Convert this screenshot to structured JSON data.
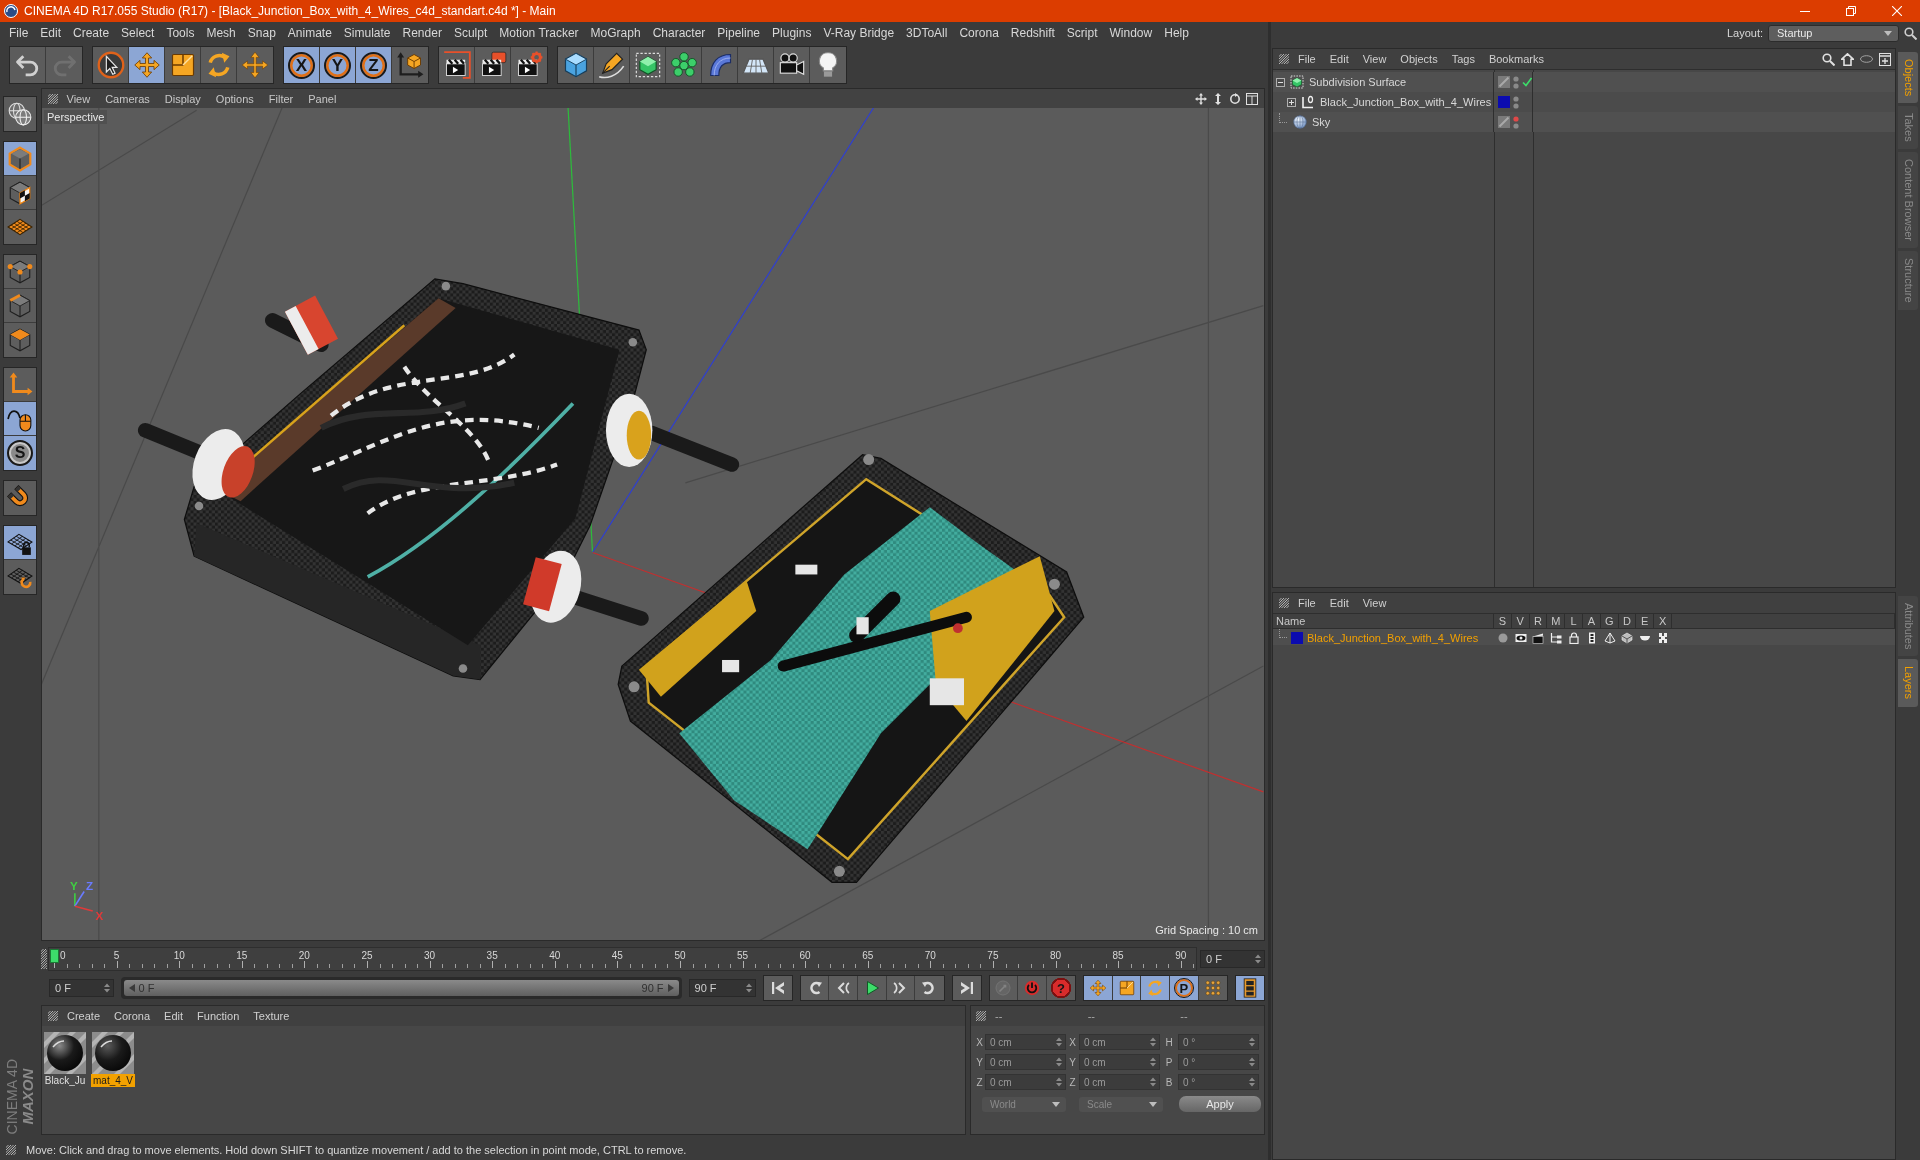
{
  "window": {
    "title": "CINEMA 4D R17.055 Studio (R17) - [Black_Junction_Box_with_4_Wires_c4d_standart.c4d *] - Main"
  },
  "menu_bar": [
    "File",
    "Edit",
    "Create",
    "Select",
    "Tools",
    "Mesh",
    "Snap",
    "Animate",
    "Simulate",
    "Render",
    "Sculpt",
    "Motion Tracker",
    "MoGraph",
    "Character",
    "Pipeline",
    "Plugins",
    "V-Ray Bridge",
    "3DToAll",
    "Corona",
    "Redshift",
    "Script",
    "Window",
    "Help"
  ],
  "layout": {
    "label": "Layout:",
    "value": "Startup"
  },
  "toolbar": [
    [
      {
        "disabled": false
      },
      {
        "disabled": true
      }
    ],
    [
      {
        "on": false
      },
      {
        "on": true
      },
      {
        "on": false
      },
      {
        "on": false
      },
      {
        "on": false
      }
    ],
    [
      {
        "label": "X",
        "on": true
      },
      {
        "label": "Y",
        "on": true
      },
      {
        "label": "Z",
        "on": true
      },
      {
        "on": false
      }
    ],
    [
      {
        "on": false
      },
      {
        "on": false
      },
      {
        "on": false
      }
    ],
    [
      {
        "on": false
      },
      {
        "on": false
      },
      {
        "on": false
      },
      {
        "on": false
      },
      {
        "on": false
      },
      {
        "on": false
      },
      {
        "on": false
      },
      {
        "on": false
      }
    ]
  ],
  "tool_palette": [
    [
      {
        "on": false
      }
    ],
    [
      {
        "on": true
      },
      {
        "on": false
      },
      {
        "on": false
      }
    ],
    [
      {
        "on": false
      },
      {
        "on": false
      },
      {
        "on": false
      }
    ],
    [
      {
        "on": false
      },
      {
        "on": true
      },
      {
        "label": "S",
        "on": true
      }
    ],
    [
      {
        "on": false
      }
    ],
    [
      {
        "on": true
      },
      {
        "on": false
      }
    ]
  ],
  "viewport": {
    "menu": [
      "View",
      "Cameras",
      "Display",
      "Options",
      "Filter",
      "Panel"
    ],
    "camera": "Perspective",
    "gizmo": [
      {
        "label": "Y",
        "color": "#3fd042"
      },
      {
        "label": "Z",
        "color": "#6a7bff"
      },
      {
        "label": "X",
        "color": "#e03a3a"
      }
    ],
    "grid_spacing": "Grid Spacing : 10 cm"
  },
  "timeline": {
    "ticks": [
      "0",
      "5",
      "10",
      "15",
      "20",
      "25",
      "30",
      "35",
      "40",
      "45",
      "50",
      "55",
      "60",
      "65",
      "70",
      "75",
      "80",
      "85",
      "90"
    ],
    "current_frame": "0 F"
  },
  "transport": {
    "start_frame": "0 F",
    "range": {
      "start": "0 F",
      "end": "90 F",
      "level": 1
    },
    "end_frame": "90 F",
    "record_tools": [
      {
        "disabled": true
      },
      {
        "disabled": false
      },
      {
        "label": "?",
        "disabled": false
      }
    ],
    "key_tools": [
      {
        "on": true
      },
      {
        "on": true
      },
      {
        "on": true
      },
      {
        "label": "P",
        "on": true
      },
      {
        "on": false
      }
    ],
    "timeline_button": {
      "on": true
    }
  },
  "materials": {
    "menu": [
      "Create",
      "Corona",
      "Edit",
      "Function",
      "Texture"
    ],
    "items": [
      {
        "name": "Black_Ju",
        "selected": false
      },
      {
        "name": "mat_4_V",
        "selected": true
      }
    ]
  },
  "coordinates": {
    "headers": [
      "--",
      "--",
      "--"
    ],
    "rows": [
      {
        "position_axis": "X",
        "position": "0 cm",
        "size_axis": "X",
        "size": "0 cm",
        "rotation_axis": "H",
        "rotation": "0 °"
      },
      {
        "position_axis": "Y",
        "position": "0 cm",
        "size_axis": "Y",
        "size": "0 cm",
        "rotation_axis": "P",
        "rotation": "0 °"
      },
      {
        "position_axis": "Z",
        "position": "0 cm",
        "size_axis": "Z",
        "size": "0 cm",
        "rotation_axis": "B",
        "rotation": "0 °"
      }
    ],
    "dropdowns": [
      "World",
      "Scale"
    ],
    "apply": "Apply"
  },
  "status_bar": "Move: Click and drag to move elements. Hold down SHIFT to quantize movement / add to the selection in point mode, CTRL to remove.",
  "logo": {
    "top": "MAXON",
    "bottom": "CINEMA 4D"
  },
  "objects": {
    "menu": [
      "File",
      "Edit",
      "View",
      "Objects",
      "Tags",
      "Bookmarks"
    ],
    "tree": [
      {
        "name": "Subdivision Surface",
        "kind": "generator",
        "expanded": true,
        "enabled": true,
        "editor_hidden": false,
        "children": [
          {
            "name": "Black_Junction_Box_with_4_Wires",
            "kind": "null",
            "expanded": false,
            "color": "#0b0bb0",
            "editor_hidden": false
          }
        ]
      },
      {
        "name": "Sky",
        "kind": "sky",
        "editor_hidden": true
      }
    ]
  },
  "layers": {
    "menu": [
      "File",
      "Edit",
      "View"
    ],
    "columns": [
      "Name",
      "S",
      "V",
      "R",
      "M",
      "L",
      "A",
      "G",
      "D",
      "E",
      "X"
    ],
    "rows": [
      {
        "name": "Black_Junction_Box_with_4_Wires",
        "color": "#0b0bb0"
      }
    ]
  },
  "side_tabs": {
    "top": [
      {
        "label": "Objects",
        "selected": true
      },
      {
        "label": "Takes",
        "selected": false
      },
      {
        "label": "Content Browser",
        "selected": false
      },
      {
        "label": "Structure",
        "selected": false
      }
    ],
    "bottom": [
      {
        "label": "Attributes",
        "selected": false
      },
      {
        "label": "Layers",
        "selected": true
      }
    ]
  }
}
